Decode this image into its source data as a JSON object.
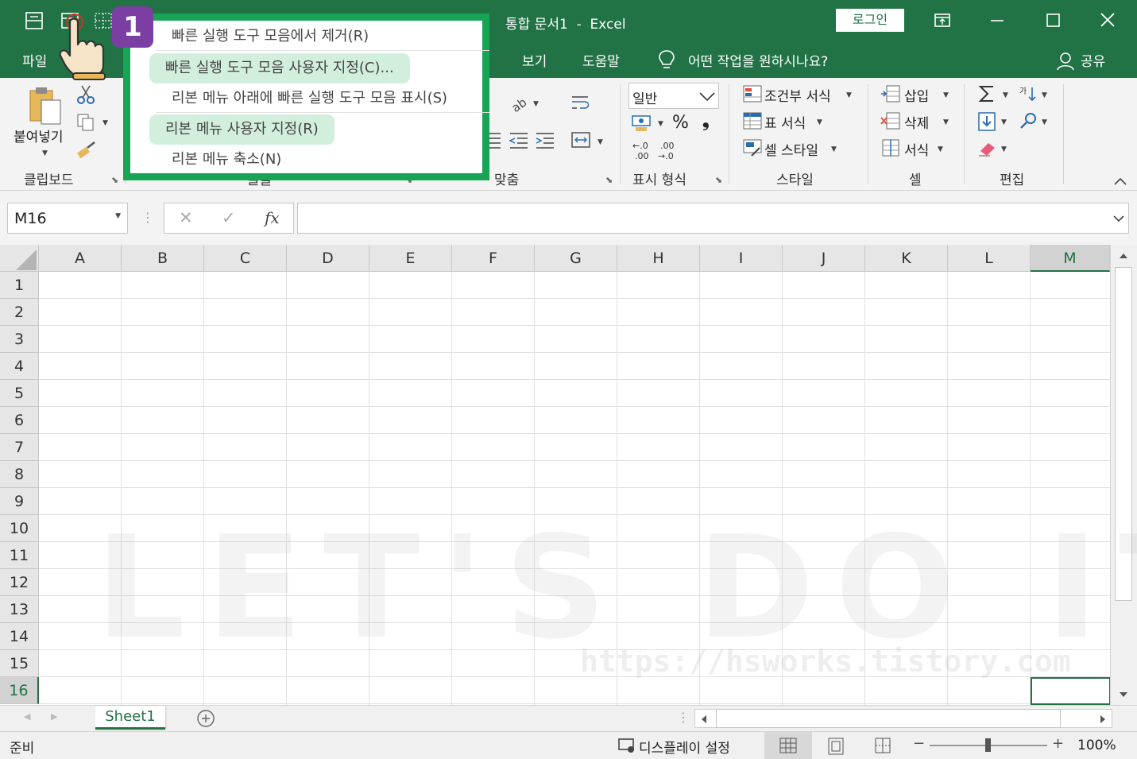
{
  "titlebar": {
    "title": "통합 문서1  -  Excel",
    "login_label": "로그인"
  },
  "menu": {
    "file": "파일",
    "view": "보기",
    "help": "도움말",
    "tell_me": "어떤 작업을 원하시나요?",
    "share": "공유"
  },
  "ribbon": {
    "clipboard": {
      "paste": "붙여넣기",
      "label": "클립보드"
    },
    "font": {
      "label": "글꼴"
    },
    "alignment": {
      "label": "맞춤"
    },
    "number": {
      "format_value": "일반",
      "label": "표시 형식",
      "percent": "%",
      "comma": "❟"
    },
    "styles": {
      "conditional": "조건부 서식",
      "table": "표 서식",
      "cell_style": "셀 스타일",
      "label": "스타일"
    },
    "cells": {
      "insert": "삽입",
      "delete": "삭제",
      "format": "서식",
      "label": "셀"
    },
    "editing": {
      "label": "편집"
    }
  },
  "formula_bar": {
    "name_box": "M16",
    "cancel": "✕",
    "enter": "✓",
    "fx": "fx",
    "formula": ""
  },
  "grid": {
    "columns": [
      "A",
      "B",
      "C",
      "D",
      "E",
      "F",
      "G",
      "H",
      "I",
      "J",
      "K",
      "L",
      "M"
    ],
    "rows": [
      "1",
      "2",
      "3",
      "4",
      "5",
      "6",
      "7",
      "8",
      "9",
      "10",
      "11",
      "12",
      "13",
      "14",
      "15",
      "16"
    ],
    "selected_cell": "M16"
  },
  "sheets": {
    "active": "Sheet1"
  },
  "status": {
    "ready": "준비",
    "display_settings": "디스플레이 설정",
    "zoom": "100%"
  },
  "context_menu": {
    "items": [
      "빠른 실행 도구 모음에서 제거(R)",
      "빠른 실행 도구 모음 사용자 지정(C)...",
      "리본 메뉴 아래에 빠른 실행 도구 모음 표시(S)",
      "리본 메뉴 사용자 지정(R)",
      "리본 메뉴 축소(N)"
    ]
  },
  "overlay": {
    "step": "1",
    "watermark": "LET'S DO IT",
    "watermark_url": "https://hsworks.tistory.com"
  },
  "colors": {
    "excel_green": "#217346",
    "menu_border": "#17a455",
    "highlight": "#d2eedd",
    "badge": "#7b3fa4"
  }
}
